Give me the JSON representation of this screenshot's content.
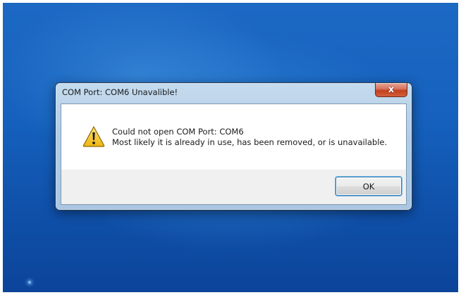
{
  "dialog": {
    "title": "COM Port: COM6 Unavalible!",
    "close_label": "x",
    "message_line1": "Could not open COM Port: COM6",
    "message_line2": "Most likely it is already in use, has been removed, or is unavailable.",
    "ok_label": "OK",
    "icon": "warning-icon"
  },
  "colors": {
    "desktop_blue": "#1561bd",
    "close_red": "#c1401f",
    "warning_yellow": "#f5c518"
  }
}
